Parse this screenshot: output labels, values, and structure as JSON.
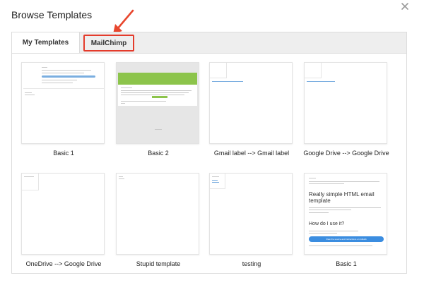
{
  "dialog": {
    "title": "Browse Templates"
  },
  "tabs": [
    {
      "label": "My Templates",
      "active": true
    },
    {
      "label": "MailChimp",
      "active": false,
      "highlighted": true
    }
  ],
  "templates": [
    {
      "name": "Basic 1"
    },
    {
      "name": "Basic 2"
    },
    {
      "name": "Gmail label --> Gmail label"
    },
    {
      "name": "Google Drive --> Google Drive"
    },
    {
      "name": "OneDrive --> Google Drive"
    },
    {
      "name": "Stupid template"
    },
    {
      "name": "testing"
    },
    {
      "name": "Basic 1"
    }
  ],
  "preview_basic1_b": {
    "heading": "Really simple HTML email template",
    "subheading": "How do I use it?",
    "button": "View the source and instructions on GitHub"
  },
  "icons": {
    "close": "close-icon",
    "annotation": "red-arrow-annotation"
  },
  "colors": {
    "highlight": "#e43b2b",
    "mailchimp_green": "#8cc44b",
    "link_blue": "#3b8de0"
  }
}
